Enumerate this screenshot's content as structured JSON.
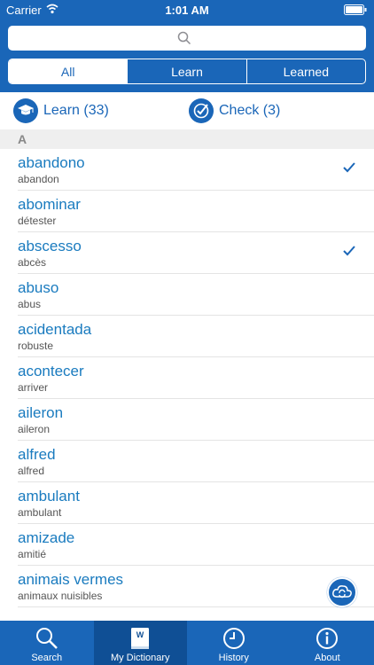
{
  "status": {
    "carrier": "Carrier",
    "time": "1:01 AM"
  },
  "search": {
    "placeholder": ""
  },
  "segments": [
    "All",
    "Learn",
    "Learned"
  ],
  "actions": {
    "learn_label": "Learn (33)",
    "check_label": "Check (3)"
  },
  "section": {
    "letter": "A"
  },
  "entries": [
    {
      "word": "abandono",
      "translation": "abandon",
      "learned": true
    },
    {
      "word": "abominar",
      "translation": "détester",
      "learned": false
    },
    {
      "word": "abscesso",
      "translation": "abcès",
      "learned": true
    },
    {
      "word": "abuso",
      "translation": "abus",
      "learned": false
    },
    {
      "word": "acidentada",
      "translation": "robuste",
      "learned": false
    },
    {
      "word": "acontecer",
      "translation": "arriver",
      "learned": false
    },
    {
      "word": "aileron",
      "translation": "aileron",
      "learned": false
    },
    {
      "word": "alfred",
      "translation": "alfred",
      "learned": false
    },
    {
      "word": "ambulant",
      "translation": "ambulant",
      "learned": false
    },
    {
      "word": "amizade",
      "translation": "amitié",
      "learned": false
    },
    {
      "word": "animais vermes",
      "translation": "animaux nuisibles",
      "learned": false
    }
  ],
  "tabs": [
    {
      "label": "Search",
      "icon": "search-icon"
    },
    {
      "label": "My Dictionary",
      "icon": "book-icon"
    },
    {
      "label": "History",
      "icon": "clock-icon"
    },
    {
      "label": "About",
      "icon": "info-icon"
    }
  ],
  "colors": {
    "brand": "#1a66b8",
    "link": "#1a7bbf"
  }
}
